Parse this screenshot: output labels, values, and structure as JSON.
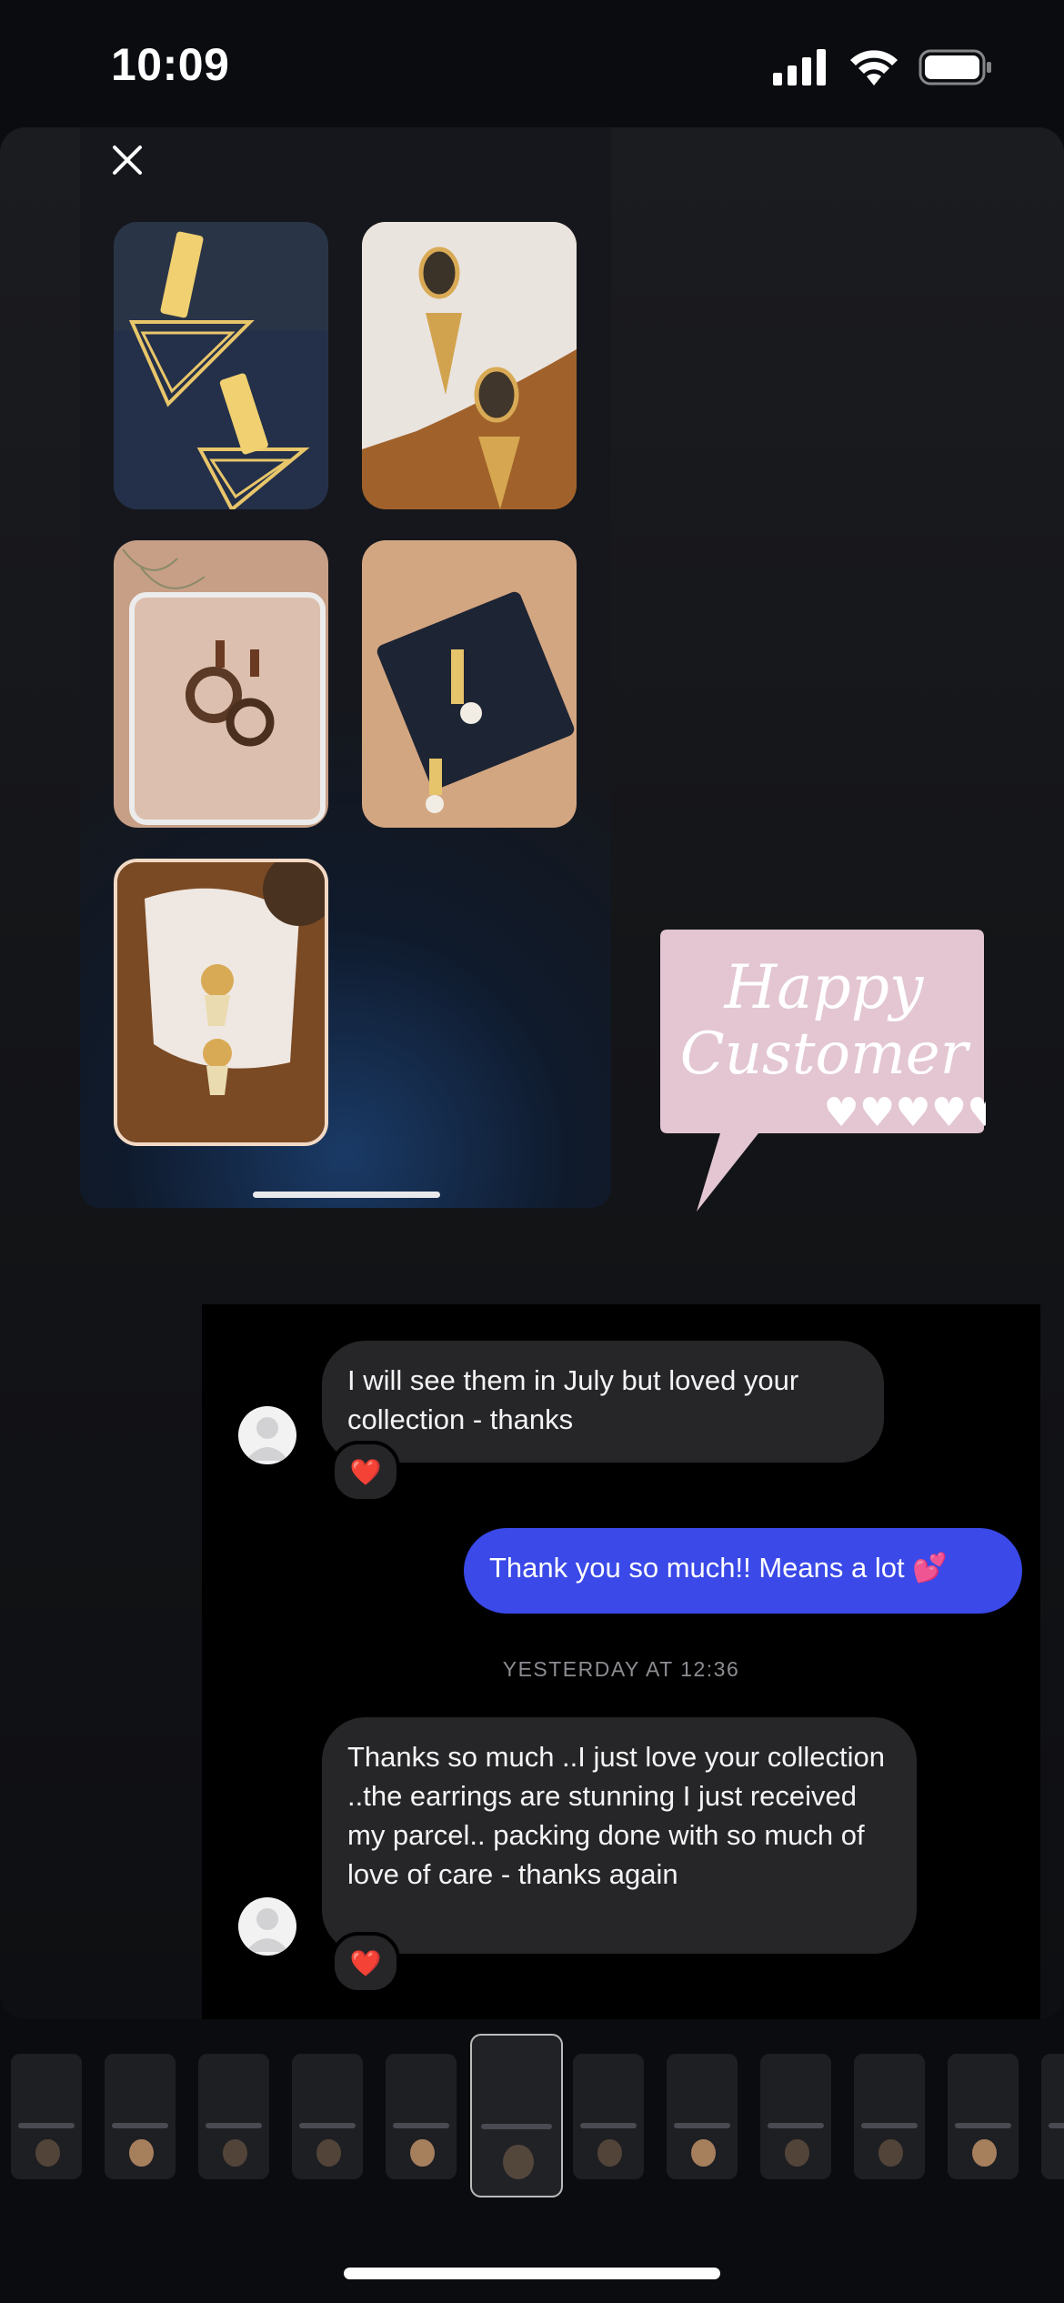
{
  "status_bar": {
    "time": "10:09"
  },
  "sticker": {
    "line1": "Happy",
    "line2": "Customer",
    "hearts": "♥♥♥♥♥"
  },
  "chat": {
    "messages": [
      {
        "from": "them",
        "text": "I will see them in July but loved your collection - thanks",
        "reaction": "❤️"
      },
      {
        "from": "me",
        "text": "Thank you so much!! Means a lot 💕"
      },
      {
        "from": "them",
        "text": "Thanks so much ..I just love your collection ..the earrings are stunning I just received my parcel.. packing done with so much of love of care - thanks again",
        "reaction": "❤️"
      }
    ],
    "timestamp": "YESTERDAY AT 12:36"
  },
  "colors": {
    "sent_bubble": "#3a49e8",
    "received_bubble": "#262629",
    "sticker_pink": "#e3c6d2"
  },
  "icons": [
    "close-icon",
    "signal-icon",
    "wifi-icon",
    "battery-icon"
  ],
  "filmstrip": {
    "frame_count": 12,
    "active_index": 5
  }
}
